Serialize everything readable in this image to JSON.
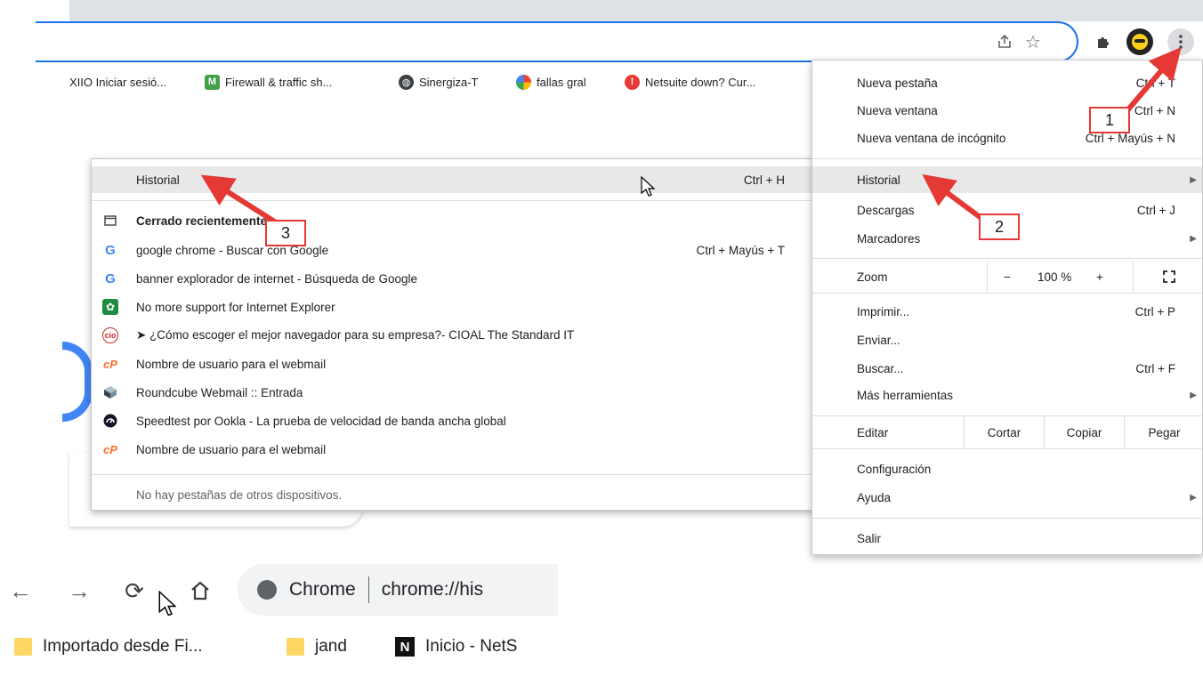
{
  "bookmarks": [
    {
      "label": "XIIO Iniciar sesió...",
      "icon": "none"
    },
    {
      "label": "Firewall & traffic sh...",
      "icon": "m-green-icon",
      "glyph": "M",
      "color": "#43a047"
    },
    {
      "label": "Sinergiza-T",
      "icon": "globe-icon"
    },
    {
      "label": "fallas gral",
      "icon": "google-sheets-icon"
    },
    {
      "label": "Netsuite down? Cur...",
      "icon": "red-alert-icon",
      "glyph": "!",
      "color": "#e53935"
    }
  ],
  "history_menu": {
    "header": {
      "label": "Historial",
      "shortcut": "Ctrl + H"
    },
    "recent_title": "Cerrado recientemente",
    "items": [
      {
        "label": "google chrome - Buscar con Google",
        "shortcut": "Ctrl + Mayús + T",
        "icon": "google-icon"
      },
      {
        "label": "banner explorador de internet - Búsqueda de Google",
        "shortcut": "",
        "icon": "google-icon"
      },
      {
        "label": "No more support for Internet Explorer",
        "shortcut": "",
        "icon": "green-logo-icon"
      },
      {
        "label": "➤ ¿Cómo escoger el mejor navegador para su empresa?- CIOAL The Standard IT",
        "shortcut": "",
        "icon": "cio-icon",
        "glyph": "cio"
      },
      {
        "label": "Nombre de usuario para el webmail",
        "shortcut": "",
        "icon": "cpanel-icon",
        "glyph": "cP"
      },
      {
        "label": "Roundcube Webmail :: Entrada",
        "shortcut": "",
        "icon": "roundcube-icon"
      },
      {
        "label": "Speedtest por Ookla - La prueba de velocidad de banda ancha global",
        "shortcut": "",
        "icon": "speedtest-icon"
      },
      {
        "label": "Nombre de usuario para el webmail",
        "shortcut": "",
        "icon": "cpanel-icon",
        "glyph": "cP"
      }
    ],
    "footer": "No hay pestañas de otros dispositivos."
  },
  "main_menu": {
    "new_tab": {
      "label": "Nueva pestaña",
      "shortcut": "Ctrl + T"
    },
    "new_window": {
      "label": "Nueva ventana",
      "shortcut": "Ctrl + N"
    },
    "incognito": {
      "label": "Nueva ventana de incógnito",
      "shortcut": "Ctrl + Mayús + N"
    },
    "history": {
      "label": "Historial"
    },
    "downloads": {
      "label": "Descargas",
      "shortcut": "Ctrl + J"
    },
    "bookmarks": {
      "label": "Marcadores"
    },
    "zoom": {
      "label": "Zoom",
      "minus": "−",
      "value": "100 %",
      "plus": "+"
    },
    "print": {
      "label": "Imprimir...",
      "shortcut": "Ctrl + P"
    },
    "cast": {
      "label": "Enviar..."
    },
    "find": {
      "label": "Buscar...",
      "shortcut": "Ctrl + F"
    },
    "more_tools": {
      "label": "Más herramientas"
    },
    "edit": {
      "label": "Editar",
      "cut": "Cortar",
      "copy": "Copiar",
      "paste": "Pegar"
    },
    "settings": {
      "label": "Configuración"
    },
    "help": {
      "label": "Ayuda"
    },
    "exit": {
      "label": "Salir"
    }
  },
  "callouts": [
    "1",
    "2",
    "3"
  ],
  "bg": {
    "omnibox_prefix": "Chrome",
    "omnibox_url": "chrome://his",
    "bookmarks": [
      "Importado desde Fi...",
      "jand",
      "Inicio - NetS"
    ]
  },
  "colors": {
    "accent": "#1a73e8",
    "callout_red": "#e53935",
    "menu_hover": "#e8e8e8"
  }
}
